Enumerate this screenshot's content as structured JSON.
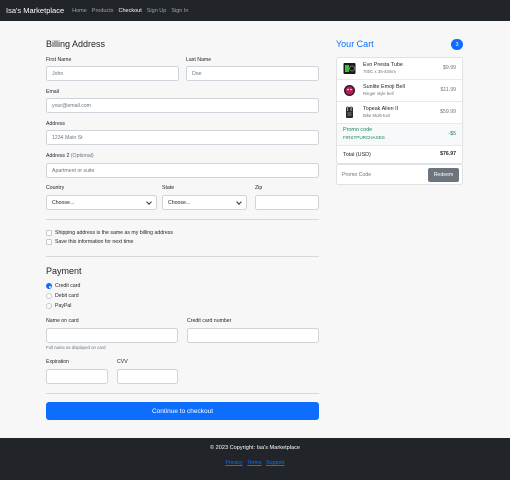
{
  "nav": {
    "brand": "Isa's Marketplace",
    "links": [
      "Home",
      "Products",
      "Checkout",
      "Sign Up",
      "Sign In"
    ],
    "active": "Checkout"
  },
  "billing": {
    "title": "Billing Address",
    "first_name": {
      "label": "First Name",
      "placeholder": "John"
    },
    "last_name": {
      "label": "Last Name",
      "placeholder": "Doe"
    },
    "email": {
      "label": "Email",
      "placeholder": "your@email.com"
    },
    "address": {
      "label": "Address",
      "placeholder": "1234 Main St"
    },
    "address2": {
      "label": "Address 2",
      "optional": "(Optional)",
      "placeholder": "Apartment or suite"
    },
    "country": {
      "label": "Country",
      "value": "Choose..."
    },
    "state": {
      "label": "State",
      "value": "Choose..."
    },
    "zip": {
      "label": "Zip",
      "placeholder": ""
    }
  },
  "options": {
    "same_address": "Shipping address is the same as my billing address",
    "save_info": "Save this information for next time"
  },
  "payment": {
    "title": "Payment",
    "methods": [
      "Credit card",
      "Debit card",
      "PayPal"
    ],
    "selected": "Credit card",
    "name_on_card": {
      "label": "Name on card",
      "help": "Full name as displayed on card"
    },
    "card_number": {
      "label": "Credit card number"
    },
    "expiration": {
      "label": "Expiration"
    },
    "cvv": {
      "label": "CVV"
    },
    "submit_label": "Continue to checkout"
  },
  "cart": {
    "title": "Your Cart",
    "count": "3",
    "items": [
      {
        "name": "Evo Presta Tube",
        "desc": "700C x 35-44mm",
        "price": "$9.99",
        "icon": "tube-icon"
      },
      {
        "name": "Sunlite Emoji Bell",
        "desc": "Ringer style bell",
        "price": "$11.99",
        "icon": "bell-icon"
      },
      {
        "name": "Topeak Alien II",
        "desc": "Bike Multi-tool",
        "price": "$59.99",
        "icon": "multitool-icon"
      }
    ],
    "promo": {
      "label": "Promo code",
      "code": "FIRSTPURCHASES",
      "value": "-$5"
    },
    "total": {
      "label": "Total (USD)",
      "value": "$76.97"
    },
    "promo_input": {
      "placeholder": "Promo Code",
      "button": "Redeem"
    }
  },
  "footer": {
    "copyright": "© 2023 Copyright: Isa's Marketplace",
    "links": [
      "Privacy",
      "Terms",
      "Support"
    ]
  },
  "colors": {
    "accent": "#0d6efd",
    "navbar": "#212529",
    "success": "#198754",
    "secondary": "#6c757d"
  }
}
